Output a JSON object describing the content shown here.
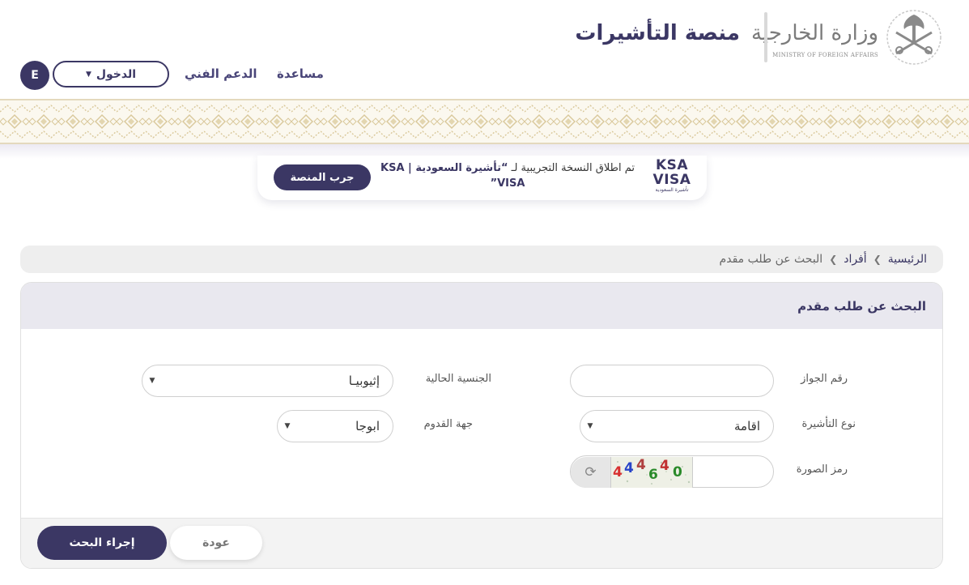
{
  "header": {
    "ministry_name_ar": "وزارة الخارجية",
    "ministry_name_en": "MINISTRY OF FOREIGN AFFAIRS",
    "platform_title": "منصة التأشيرات",
    "nav": {
      "help": "مساعدة",
      "support": "الدعم الفني",
      "login": "الدخول",
      "language": "E"
    }
  },
  "promo": {
    "logo_line1": "KSA",
    "logo_line2": "VISA",
    "logo_subtitle": "تأشيرة السعودية",
    "text_prefix": "تم اطلاق النسخة التجريبية لـ ",
    "text_bold": "“تأشيرة السعودية | KSA VISA”",
    "button": "جرب المنصة"
  },
  "breadcrumb": {
    "home": "الرئيسية",
    "individuals": "أفراد",
    "current": "البحث عن طلب مقدم"
  },
  "form": {
    "title": "البحث عن طلب مقدم",
    "passport_label": "رقم الجواز",
    "passport_value": "",
    "nationality_label": "الجنسية الحالية",
    "nationality_value": "إثيوبيـا",
    "visa_type_label": "نوع التأشيرة",
    "visa_type_value": "اقامة",
    "arrival_label": "جهة القدوم",
    "arrival_value": "ابوجا",
    "captcha_label": "رمز الصورة",
    "captcha_text": "444640",
    "captcha_input_value": "",
    "back_button": "عودة",
    "search_button": "إجراء البحث"
  },
  "icons": {
    "refresh": "refresh-icon",
    "caret": "caret-down-icon",
    "breadcrumb_separator": "chevron-left-icon"
  },
  "colors": {
    "primary": "#3b3764",
    "pattern_gold": "#d9c89a",
    "card_header": "#e9e8ef"
  }
}
